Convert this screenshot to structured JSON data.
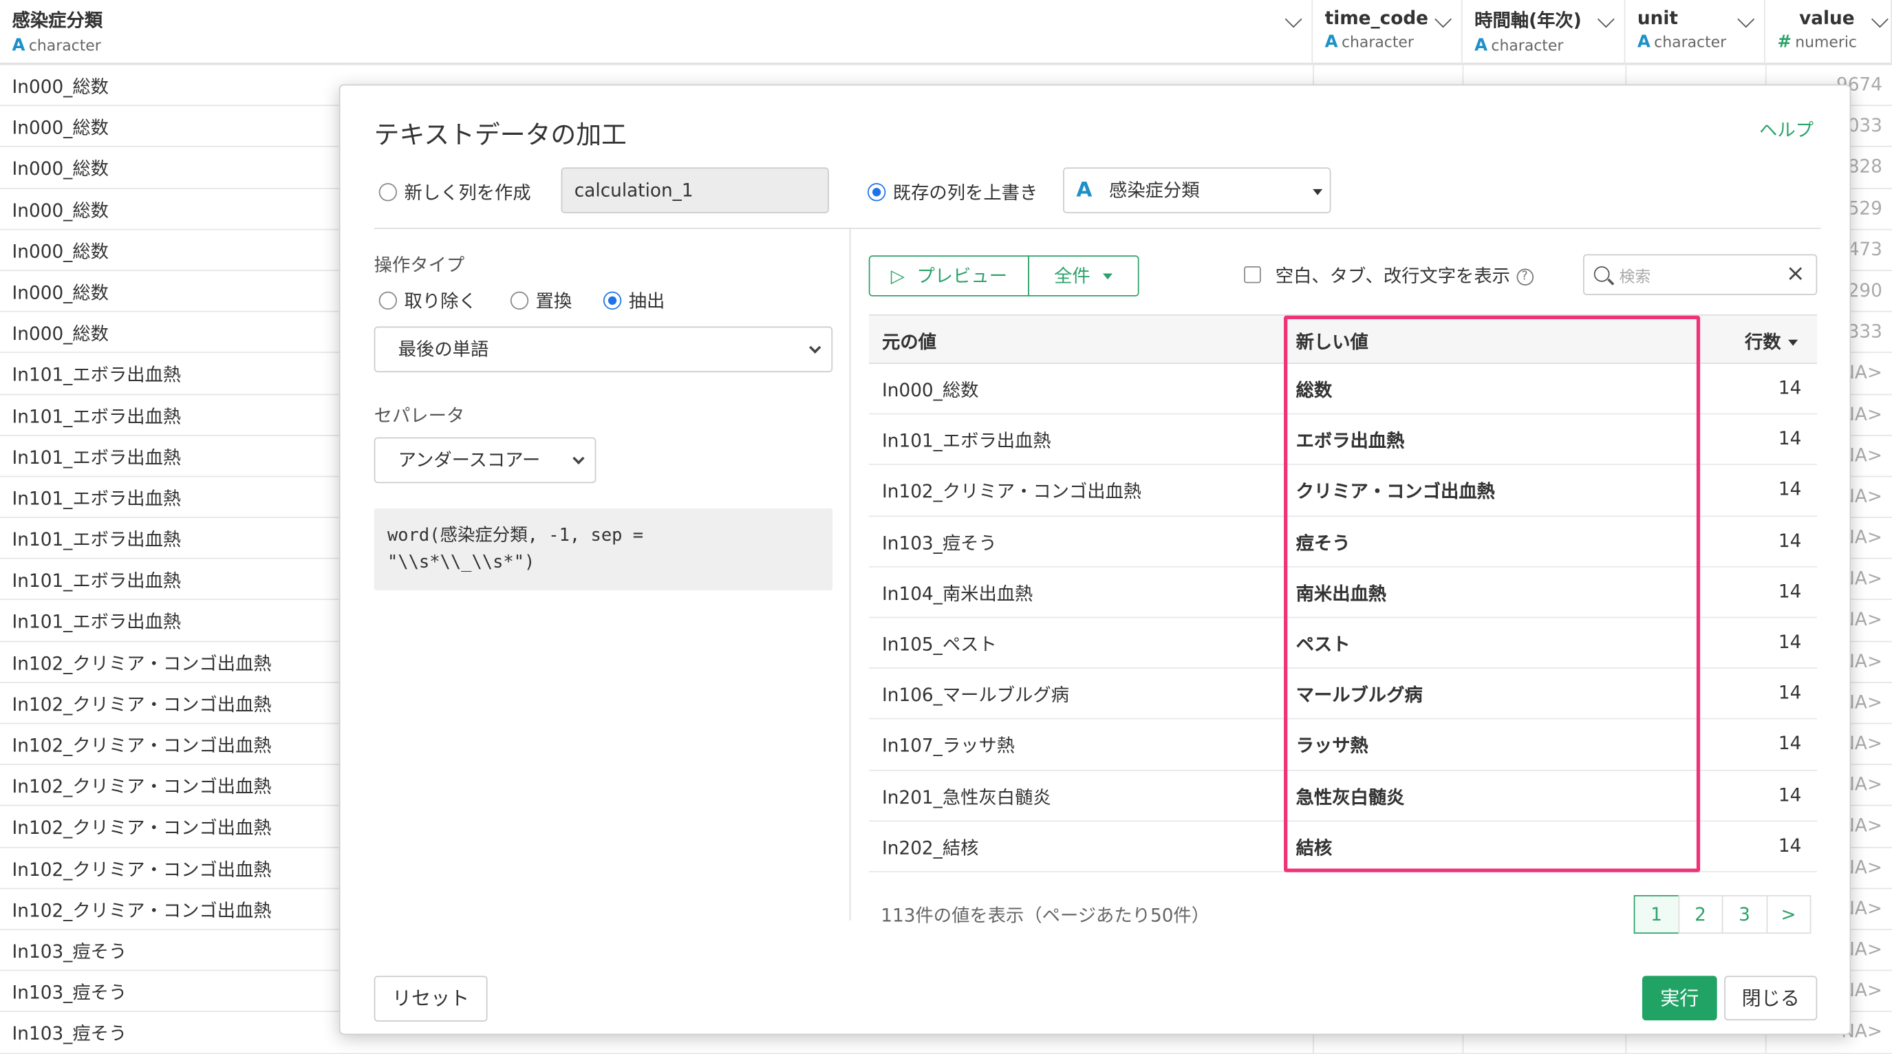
{
  "grid": {
    "columns": [
      {
        "name": "感染症分類",
        "type_icon": "A",
        "type": "character"
      },
      {
        "name": "time_code",
        "type_icon": "A",
        "type": "character"
      },
      {
        "name": "時間軸(年次)",
        "type_icon": "A",
        "type": "character"
      },
      {
        "name": "unit",
        "type_icon": "A",
        "type": "character"
      },
      {
        "name": "value",
        "type_icon": "#",
        "type": "numeric"
      }
    ],
    "rows": [
      {
        "category": "In000_総数",
        "value": "9674"
      },
      {
        "category": "In000_総数",
        "value": "033"
      },
      {
        "category": "In000_総数",
        "value": "828"
      },
      {
        "category": "In000_総数",
        "value": "529"
      },
      {
        "category": "In000_総数",
        "value": "473"
      },
      {
        "category": "In000_総数",
        "value": "290"
      },
      {
        "category": "In000_総数",
        "value": "333"
      },
      {
        "category": "In101_エボラ出血熱",
        "value": "NA>"
      },
      {
        "category": "In101_エボラ出血熱",
        "value": "NA>"
      },
      {
        "category": "In101_エボラ出血熱",
        "value": "NA>"
      },
      {
        "category": "In101_エボラ出血熱",
        "value": "NA>"
      },
      {
        "category": "In101_エボラ出血熱",
        "value": "NA>"
      },
      {
        "category": "In101_エボラ出血熱",
        "value": "NA>"
      },
      {
        "category": "In101_エボラ出血熱",
        "value": "NA>"
      },
      {
        "category": "In102_クリミア・コンゴ出血熱",
        "value": "NA>"
      },
      {
        "category": "In102_クリミア・コンゴ出血熱",
        "value": "NA>"
      },
      {
        "category": "In102_クリミア・コンゴ出血熱",
        "value": "NA>"
      },
      {
        "category": "In102_クリミア・コンゴ出血熱",
        "value": "NA>"
      },
      {
        "category": "In102_クリミア・コンゴ出血熱",
        "value": "NA>"
      },
      {
        "category": "In102_クリミア・コンゴ出血熱",
        "value": "NA>"
      },
      {
        "category": "In102_クリミア・コンゴ出血熱",
        "value": "NA>"
      },
      {
        "category": "In103_痘そう",
        "value": "NA>"
      },
      {
        "category": "In103_痘そう",
        "value": "NA>"
      },
      {
        "category": "In103_痘そう",
        "value": "NA>"
      }
    ]
  },
  "dialog": {
    "title": "テキストデータの加工",
    "help": "ヘルプ",
    "new_column_label": "新しく列を作成",
    "new_column_value": "calculation_1",
    "overwrite_label": "既存の列を上書き",
    "overwrite_type_icon": "A",
    "overwrite_column": "感染症分類",
    "operation_type_label": "操作タイプ",
    "operations": [
      "取り除く",
      "置換",
      "抽出"
    ],
    "selected_operation": "抽出",
    "extract_select": "最後の単語",
    "separator_label": "セパレータ",
    "separator_select": "アンダースコアー",
    "code": "word(感染症分類, -1, sep =\n\"\\\\s*\\\\_\\\\s*\")",
    "preview_button": "プレビュー",
    "scope_button": "全件",
    "show_whitespace_label": "空白、タブ、改行文字を表示",
    "search_placeholder": "検索",
    "table": {
      "headers": {
        "original": "元の値",
        "new": "新しい値",
        "count": "行数"
      },
      "rows": [
        {
          "original": "In000_総数",
          "new": "総数",
          "count": "14"
        },
        {
          "original": "In101_エボラ出血熱",
          "new": "エボラ出血熱",
          "count": "14"
        },
        {
          "original": "In102_クリミア・コンゴ出血熱",
          "new": "クリミア・コンゴ出血熱",
          "count": "14"
        },
        {
          "original": "In103_痘そう",
          "new": "痘そう",
          "count": "14"
        },
        {
          "original": "In104_南米出血熱",
          "new": "南米出血熱",
          "count": "14"
        },
        {
          "original": "In105_ペスト",
          "new": "ペスト",
          "count": "14"
        },
        {
          "original": "In106_マールブルグ病",
          "new": "マールブルグ病",
          "count": "14"
        },
        {
          "original": "In107_ラッサ熱",
          "new": "ラッサ熱",
          "count": "14"
        },
        {
          "original": "In201_急性灰白髄炎",
          "new": "急性灰白髄炎",
          "count": "14"
        },
        {
          "original": "In202_結核",
          "new": "結核",
          "count": "14"
        }
      ]
    },
    "footer_text": "113件の値を表示（ページあたり50件）",
    "pages": [
      "1",
      "2",
      "3",
      ">"
    ],
    "reset": "リセット",
    "run": "実行",
    "close": "閉じる",
    "highlight_color": "#ee3377",
    "accent_color": "#2ca36a"
  }
}
